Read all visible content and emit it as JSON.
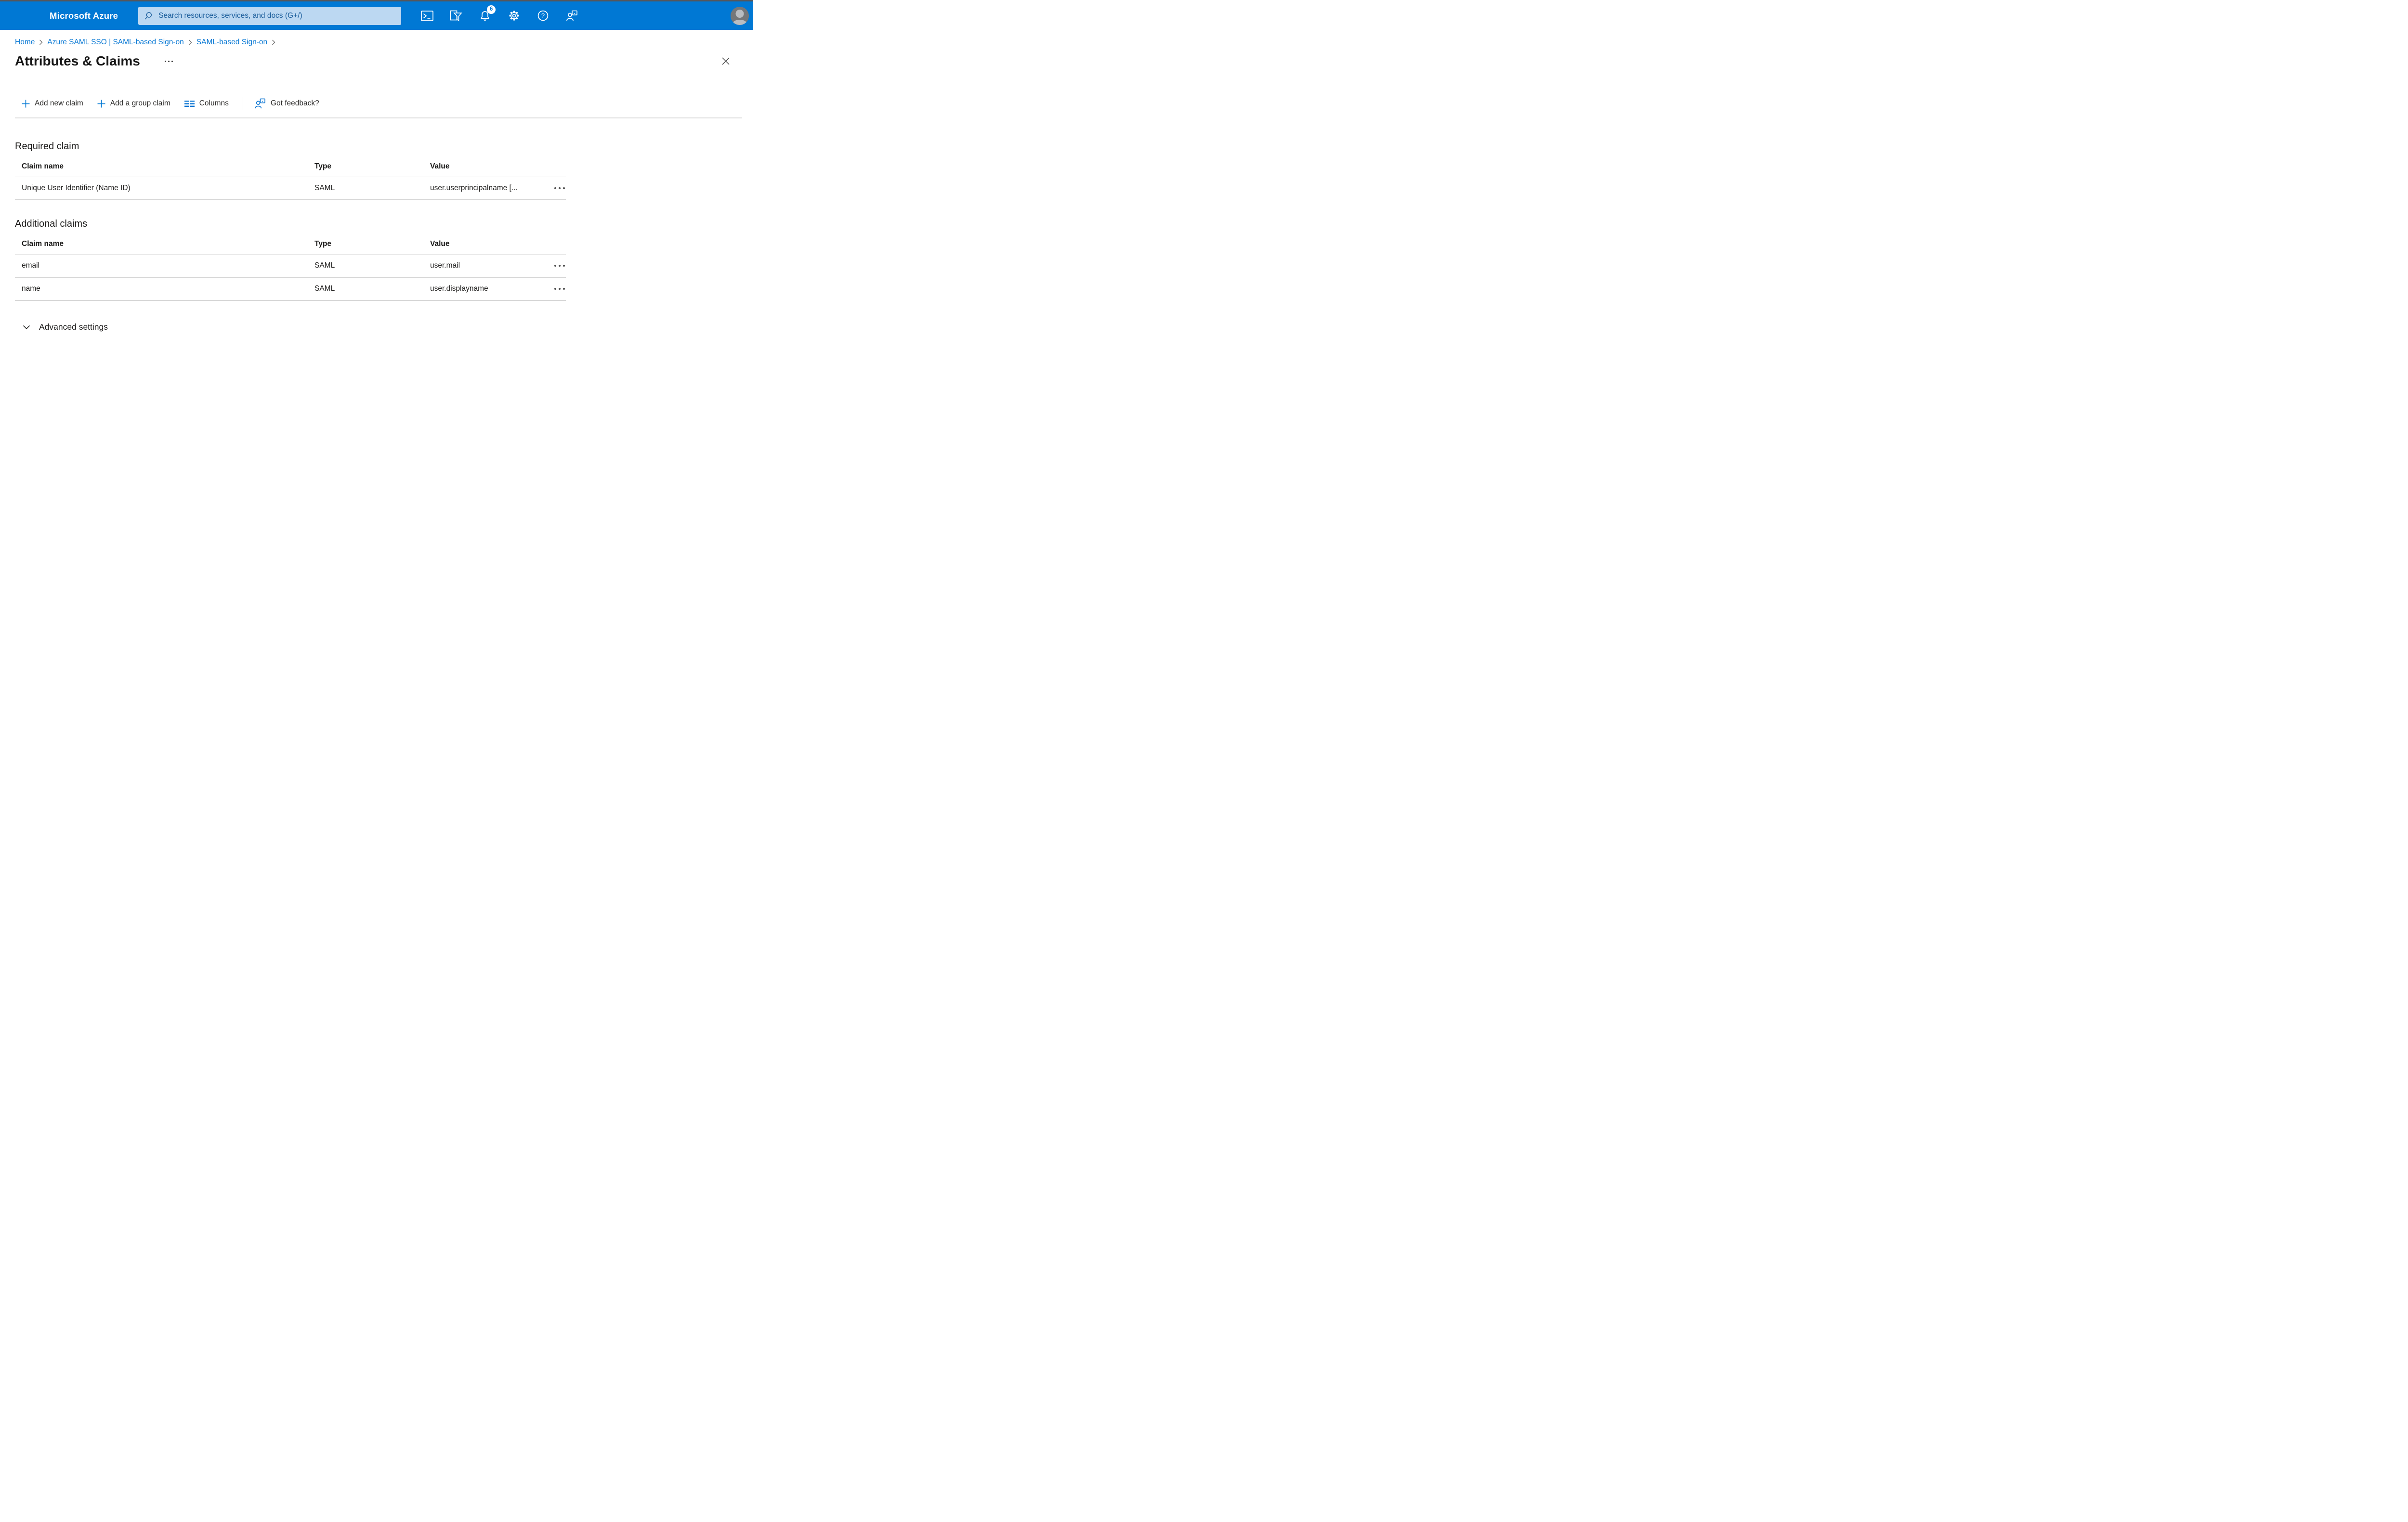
{
  "topbar": {
    "brand": "Microsoft Azure",
    "search": {
      "placeholder": "Search resources, services, and docs (G+/)"
    },
    "notifications_badge": "6",
    "icon_names": [
      "hamburger-menu-icon",
      "search-icon",
      "cloud-shell-icon",
      "directory-filter-icon",
      "notifications-bell-icon",
      "settings-gear-icon",
      "help-icon",
      "feedback-icon",
      "avatar"
    ]
  },
  "breadcrumb": {
    "items": [
      {
        "label": "Home"
      },
      {
        "label": "Azure SAML SSO | SAML-based Sign-on"
      },
      {
        "label": "SAML-based Sign-on"
      }
    ]
  },
  "page": {
    "title": "Attributes & Claims"
  },
  "toolbar": {
    "add_new_claim": "Add new claim",
    "add_group_claim": "Add a group claim",
    "columns": "Columns",
    "got_feedback": "Got feedback?"
  },
  "required_claim": {
    "heading": "Required claim",
    "columns": {
      "name": "Claim name",
      "type": "Type",
      "value": "Value"
    },
    "rows": [
      {
        "name": "Unique User Identifier (Name ID)",
        "type": "SAML",
        "value": "user.userprincipalname [..."
      }
    ]
  },
  "additional_claims": {
    "heading": "Additional claims",
    "columns": {
      "name": "Claim name",
      "type": "Type",
      "value": "Value"
    },
    "rows": [
      {
        "name": "email",
        "type": "SAML",
        "value": "user.mail"
      },
      {
        "name": "name",
        "type": "SAML",
        "value": "user.displayname"
      }
    ]
  },
  "advanced": {
    "label": "Advanced settings"
  },
  "colors": {
    "topbar": "#0078d4",
    "accent": "#0078d4",
    "search_bg": "#bcd8f2",
    "search_text": "#1a5d9b",
    "link": "#0a79d4",
    "badge_bg": "#ffffff",
    "badge_text": "#0078d4",
    "row_border": "#d6d6d6"
  }
}
